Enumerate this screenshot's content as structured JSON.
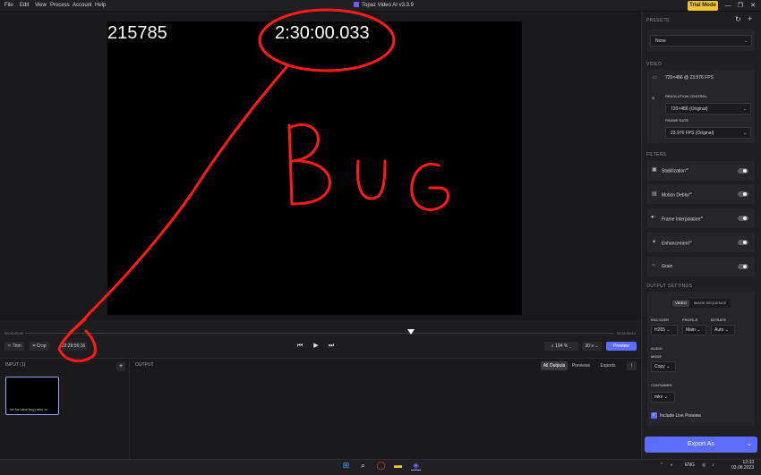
{
  "menu": [
    "File",
    "Edit",
    "View",
    "Process",
    "Account",
    "Help"
  ],
  "app_title": "Topaz Video AI  v3.3.9",
  "trial_mode": "Trial Mode",
  "window_controls": {
    "minimize": "—",
    "restore": "❐",
    "close": "✕"
  },
  "viewer": {
    "frame_count": "215785",
    "timestamp_overlay": "2:30:00.033",
    "annotation_text": "BUG"
  },
  "timeline": {
    "start": "00:00:00:00",
    "end": "02:30:58:14"
  },
  "controls": {
    "trim": "Trim",
    "crop": "Crop",
    "current_time": "02:29:56:16",
    "zoom": "194 %",
    "frame_step": "30 s",
    "preview": "Preview"
  },
  "input_panel": {
    "title": "INPUT (1)",
    "add": "+",
    "file_label": "...ire for view bug).mkv",
    "file_more": "•••"
  },
  "output_panel": {
    "title": "OUTPUT",
    "tabs": [
      "All Outputs",
      "Previews",
      "Exports"
    ],
    "upload": "↑"
  },
  "sidebar": {
    "presets_title": "PRESETS",
    "preset_value": "None",
    "video_title": "VIDEO",
    "video_info": "720×486 @ 23.976 FPS",
    "resolution_title": "RESOLUTION CONTROL",
    "resolution_value": "720×486 (Original)",
    "frame_rate_title": "FRAME RATE",
    "frame_rate_value": "23.976 FPS (Original)",
    "filters_title": "FILTERS",
    "filters": [
      {
        "label": "Stabilization",
        "icon": "stabilization-icon",
        "glyph": "▣"
      },
      {
        "label": "Motion Deblur",
        "icon": "deblur-icon",
        "glyph": "▤"
      },
      {
        "label": "Frame Interpolation",
        "icon": "interpolation-icon",
        "glyph": "●◦"
      },
      {
        "label": "Enhancement",
        "icon": "enhancement-icon",
        "glyph": "✦"
      },
      {
        "label": "Grain",
        "icon": "grain-icon",
        "glyph": "○"
      }
    ],
    "ai_badge": "AI",
    "output_settings_title": "OUTPUT SETTINGS",
    "output_tabs": [
      "VIDEO",
      "IMAGE SEQUENCE"
    ],
    "encoder_label": "ENCODER",
    "encoder_value": "H265",
    "profile_label": "PROFILE",
    "profile_value": "Main",
    "bitrate_label": "BITRATE",
    "bitrate_value": "Auto",
    "audio_title": "AUDIO",
    "mode_label": "MODE",
    "mode_value": "Copy",
    "container_title": "CONTAINER",
    "container_value": "mkv",
    "include_preview": "Include Live Preview",
    "export_label": "Export As"
  },
  "taskbar": {
    "lang": "ENG",
    "time": "12:33",
    "date": "03.08.2023"
  },
  "colors": {
    "accent": "#5b6cff",
    "trial": "#f1c232",
    "annotation": "#ff1a1a"
  }
}
